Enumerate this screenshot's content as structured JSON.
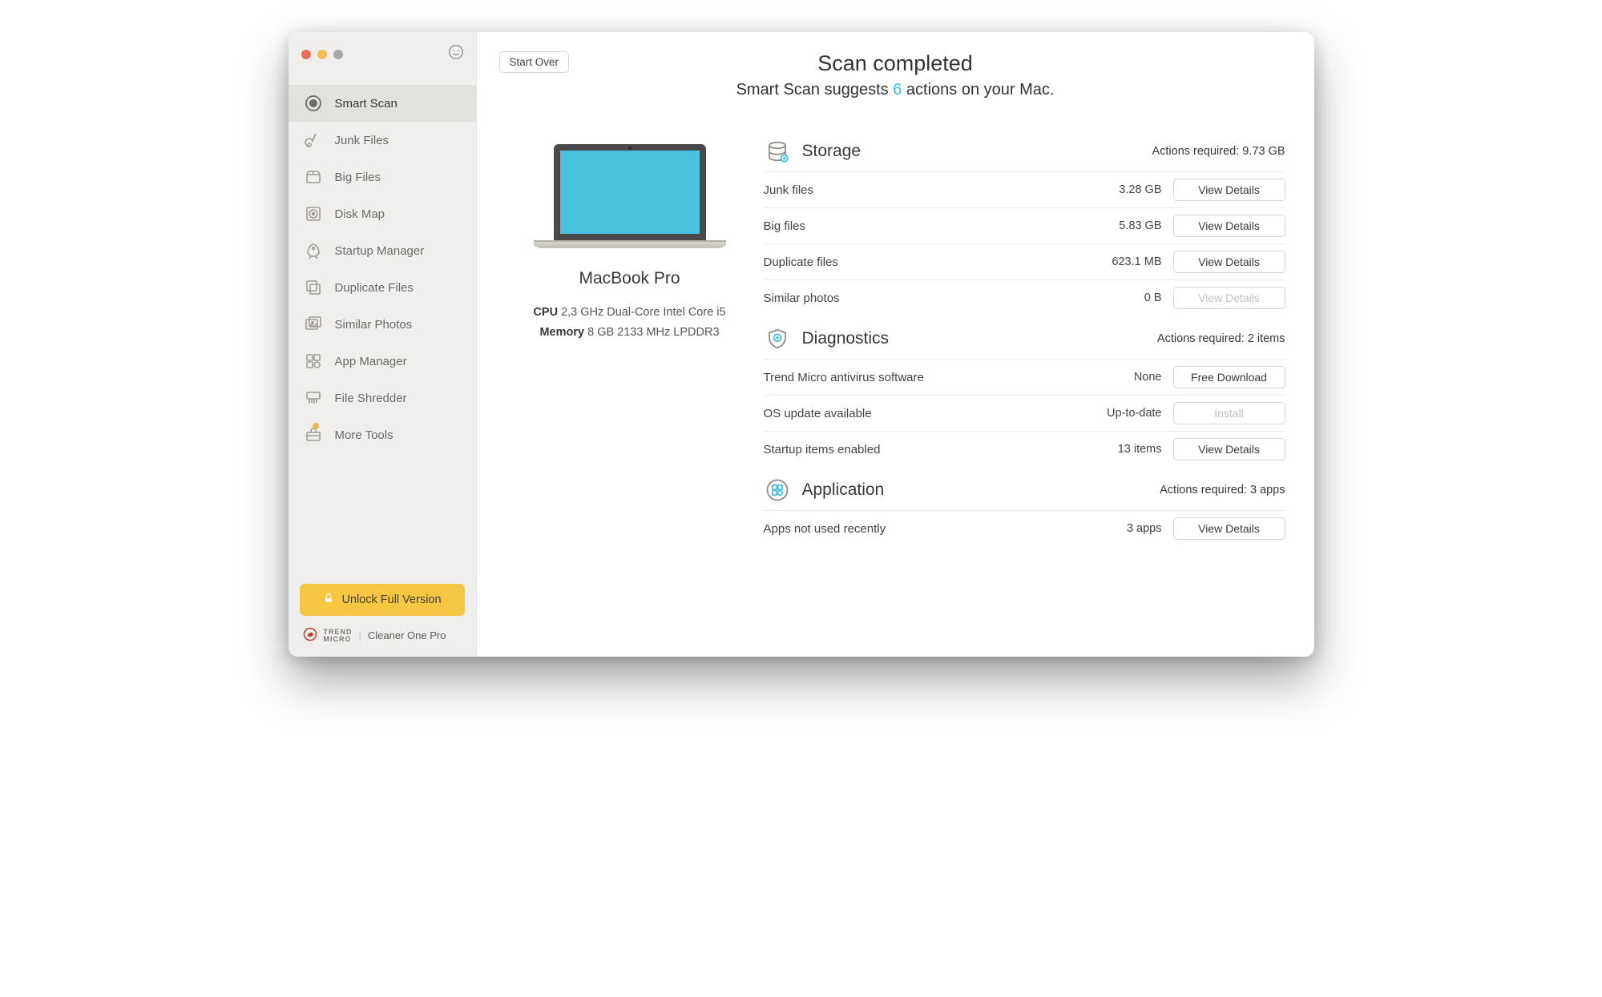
{
  "header": {
    "start_over": "Start Over",
    "title": "Scan completed",
    "subtitle_prefix": "Smart Scan suggests ",
    "action_count": "6",
    "subtitle_suffix": " actions on your Mac."
  },
  "sidebar": {
    "items": [
      {
        "label": "Smart Scan"
      },
      {
        "label": "Junk Files"
      },
      {
        "label": "Big Files"
      },
      {
        "label": "Disk Map"
      },
      {
        "label": "Startup Manager"
      },
      {
        "label": "Duplicate Files"
      },
      {
        "label": "Similar Photos"
      },
      {
        "label": "App Manager"
      },
      {
        "label": "File Shredder"
      },
      {
        "label": "More Tools"
      }
    ],
    "unlock_label": "Unlock Full Version",
    "brand_vendor": "TREND",
    "brand_vendor2": "MICRO",
    "brand_product": "Cleaner One Pro"
  },
  "device": {
    "name": "MacBook Pro",
    "cpu_label": "CPU",
    "cpu_value": "2,3 GHz Dual-Core Intel Core i5",
    "mem_label": "Memory",
    "mem_value": "8 GB 2133 MHz LPDDR3"
  },
  "sections": {
    "storage": {
      "title": "Storage",
      "required": "Actions required: 9.73 GB",
      "rows": [
        {
          "label": "Junk files",
          "value": "3.28 GB",
          "action": "View Details",
          "disabled": false
        },
        {
          "label": "Big files",
          "value": "5.83 GB",
          "action": "View Details",
          "disabled": false
        },
        {
          "label": "Duplicate files",
          "value": "623.1 MB",
          "action": "View Details",
          "disabled": false
        },
        {
          "label": "Similar photos",
          "value": "0 B",
          "action": "View Details",
          "disabled": true
        }
      ]
    },
    "diagnostics": {
      "title": "Diagnostics",
      "required": "Actions required: 2 items",
      "rows": [
        {
          "label": "Trend Micro antivirus software",
          "value": "None",
          "action": "Free Download",
          "disabled": false
        },
        {
          "label": "OS update available",
          "value": "Up-to-date",
          "action": "Install",
          "disabled": true
        },
        {
          "label": "Startup items enabled",
          "value": "13 items",
          "action": "View Details",
          "disabled": false
        }
      ]
    },
    "application": {
      "title": "Application",
      "required": "Actions required: 3 apps",
      "rows": [
        {
          "label": "Apps not used recently",
          "value": "3 apps",
          "action": "View Details",
          "disabled": false
        }
      ]
    }
  }
}
